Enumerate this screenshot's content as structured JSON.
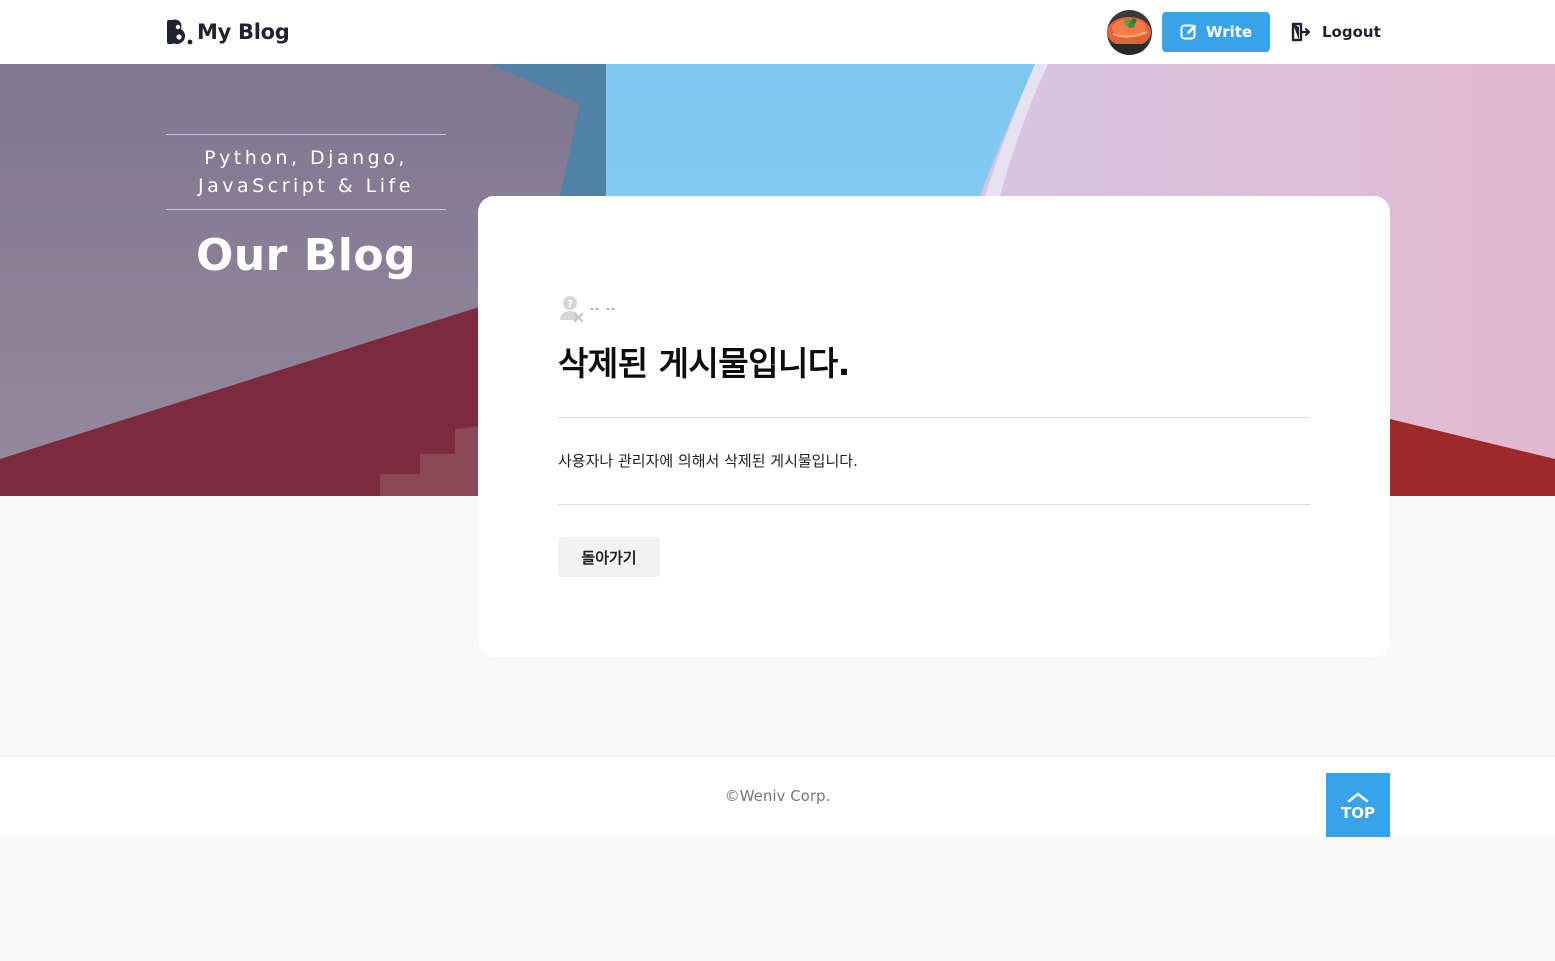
{
  "header": {
    "logo_text": "My Blog",
    "write_label": "Write",
    "logout_label": "Logout",
    "accent_color": "#38a3e8"
  },
  "hero": {
    "tagline": "Python, Django,\nJavaScript & Life",
    "title": "Our Blog"
  },
  "post": {
    "author_placeholder": "--",
    "date_placeholder": "--",
    "title": "삭제된 게시물입니다.",
    "body": "사용자나 관리자에 의해서 삭제된 게시물입니다.",
    "back_label": "돌아가기"
  },
  "footer": {
    "copyright": "©Weniv Corp.",
    "top_label": "TOP"
  },
  "icons": {
    "logo": "blog-b-logo-icon",
    "write": "pencil-edit-icon",
    "logout": "logout-door-icon",
    "author": "deleted-user-icon",
    "top": "chevron-up-icon"
  }
}
